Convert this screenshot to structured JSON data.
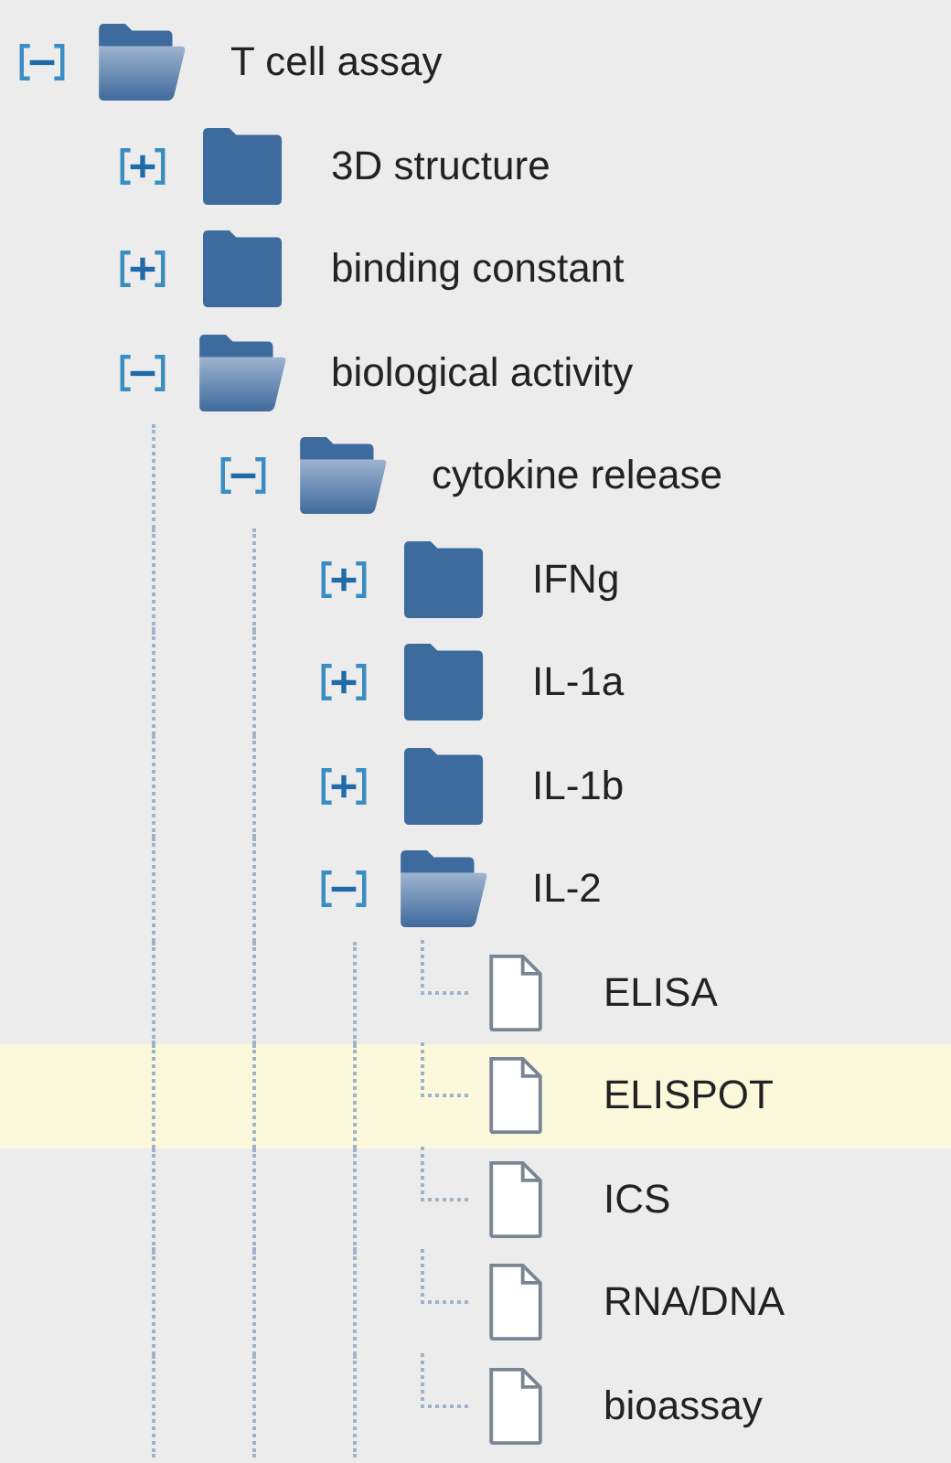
{
  "tree": [
    {
      "label": "T cell assay",
      "kind": "folder",
      "expanded": true,
      "selected": false,
      "children": [
        {
          "label": "3D structure",
          "kind": "folder",
          "expanded": false,
          "selected": false
        },
        {
          "label": "binding constant",
          "kind": "folder",
          "expanded": false,
          "selected": false
        },
        {
          "label": "biological activity",
          "kind": "folder",
          "expanded": true,
          "selected": false,
          "children": [
            {
              "label": "cytokine release",
              "kind": "folder",
              "expanded": true,
              "selected": false,
              "children": [
                {
                  "label": "IFNg",
                  "kind": "folder",
                  "expanded": false,
                  "selected": false
                },
                {
                  "label": "IL-1a",
                  "kind": "folder",
                  "expanded": false,
                  "selected": false
                },
                {
                  "label": "IL-1b",
                  "kind": "folder",
                  "expanded": false,
                  "selected": false
                },
                {
                  "label": "IL-2",
                  "kind": "folder",
                  "expanded": true,
                  "selected": false,
                  "children": [
                    {
                      "label": "ELISA",
                      "kind": "file",
                      "selected": false
                    },
                    {
                      "label": "ELISPOT",
                      "kind": "file",
                      "selected": true
                    },
                    {
                      "label": "ICS",
                      "kind": "file",
                      "selected": false
                    },
                    {
                      "label": "RNA/DNA",
                      "kind": "file",
                      "selected": false
                    },
                    {
                      "label": "bioassay",
                      "kind": "file",
                      "selected": false
                    }
                  ]
                }
              ]
            }
          ]
        }
      ]
    }
  ]
}
